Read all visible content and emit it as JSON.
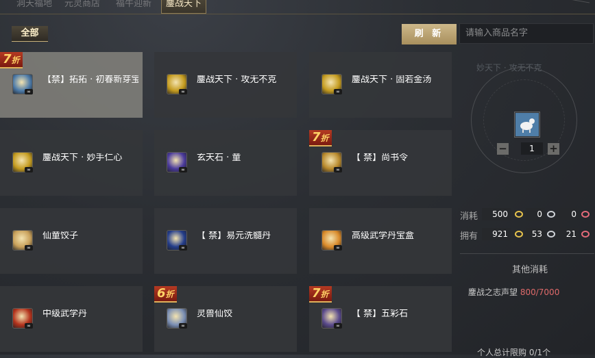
{
  "tabs": [
    "洞天福地",
    "元灵商店",
    "福牛迎新",
    "鏖战天下"
  ],
  "filter_label": "全部",
  "refresh_label": "刷 新",
  "search_placeholder": "请输入商品名字",
  "items": [
    {
      "name": "【禁】拓拓 · 初春新芽宝匣",
      "badge": "7",
      "selected": true,
      "color": "#4c7aa8"
    },
    {
      "name": "鏖战天下 · 攻无不克",
      "badge": "",
      "selected": false,
      "color": "#c49b1f"
    },
    {
      "name": "鏖战天下 · 固若金汤",
      "badge": "",
      "selected": false,
      "color": "#c49b1f"
    },
    {
      "name": "鏖战天下 · 妙手仁心",
      "badge": "",
      "selected": false,
      "color": "#c49b1f"
    },
    {
      "name": "玄天石 · 童",
      "badge": "",
      "selected": false,
      "color": "#4a3a9c"
    },
    {
      "name": "【 禁】尚书令",
      "badge": "7",
      "selected": false,
      "color": "#b8892c"
    },
    {
      "name": "仙童饺子",
      "badge": "",
      "selected": false,
      "color": "#c8a05a"
    },
    {
      "name": "【 禁】易元洗髓丹",
      "badge": "",
      "selected": false,
      "color": "#233c8a"
    },
    {
      "name": "高级武学丹宝盒",
      "badge": "",
      "selected": false,
      "color": "#d98a2a"
    },
    {
      "name": "中级武学丹",
      "badge": "",
      "selected": false,
      "color": "#b3321c"
    },
    {
      "name": "灵兽仙饺",
      "badge": "6",
      "selected": false,
      "color": "#7b8fb4"
    },
    {
      "name": "【 禁】五彩石",
      "badge": "7",
      "selected": false,
      "color": "#5a4a8c"
    }
  ],
  "badge_suffix": "折",
  "infinity_mark": "∞",
  "panel": {
    "faded_text": "妙天下 · 攻无不克",
    "quantity": "1",
    "minus": "−",
    "plus": "+",
    "cost_label": "消耗",
    "own_label": "拥有",
    "cost": [
      "500",
      "0",
      "0"
    ],
    "own": [
      "921",
      "53",
      "21"
    ],
    "other_cost_label": "其他消耗",
    "reputation_label": "鏖战之志声望",
    "reputation_value": "800/7000",
    "limit_text": "个人总计限购 0/1个"
  },
  "colors": {
    "accent": "#c9b27c",
    "discount": "#b53a22"
  }
}
